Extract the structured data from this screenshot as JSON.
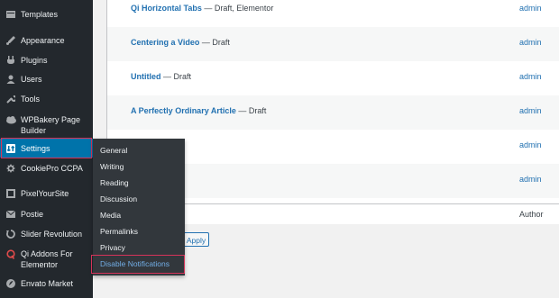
{
  "sidebar": {
    "items": [
      {
        "label": "Templates",
        "icon": "templates-icon"
      },
      {
        "label": "Appearance",
        "icon": "appearance-icon"
      },
      {
        "label": "Plugins",
        "icon": "plugins-icon"
      },
      {
        "label": "Users",
        "icon": "users-icon"
      },
      {
        "label": "Tools",
        "icon": "tools-icon"
      },
      {
        "label": "WPBakery Page Builder",
        "icon": "wpbakery-icon"
      },
      {
        "label": "Settings",
        "icon": "settings-icon"
      },
      {
        "label": "CookiePro CCPA",
        "icon": "cookiepro-icon"
      },
      {
        "label": "PixelYourSite",
        "icon": "pixelyoursite-icon"
      },
      {
        "label": "Postie",
        "icon": "postie-icon"
      },
      {
        "label": "Slider Revolution",
        "icon": "slider-revolution-icon"
      },
      {
        "label": "Qi Addons For Elementor",
        "icon": "qi-addons-icon"
      },
      {
        "label": "Envato Market",
        "icon": "envato-market-icon"
      }
    ]
  },
  "settings_submenu": {
    "items": [
      "General",
      "Writing",
      "Reading",
      "Discussion",
      "Media",
      "Permalinks",
      "Privacy",
      "Disable Notifications"
    ]
  },
  "table": {
    "rows": [
      {
        "title": "Qi Horizontal Tabs",
        "state": " — Draft, Elementor",
        "author": "admin"
      },
      {
        "title": "Centering a Video",
        "state": " — Draft",
        "author": "admin"
      },
      {
        "title": "Untitled",
        "state": " — Draft",
        "author": "admin"
      },
      {
        "title": "A Perfectly Ordinary Article",
        "state": " — Draft",
        "author": "admin"
      },
      {
        "title": "",
        "state": "",
        "author": "admin"
      },
      {
        "title": "",
        "state": "",
        "author": "admin"
      }
    ],
    "footer_author_header": "Author"
  },
  "bulk_actions": {
    "apply_label": "Apply"
  },
  "colors": {
    "sidebar_bg": "#23282d",
    "active_bg": "#0073aa",
    "highlight_border": "#d6335a",
    "link": "#2271b1"
  }
}
